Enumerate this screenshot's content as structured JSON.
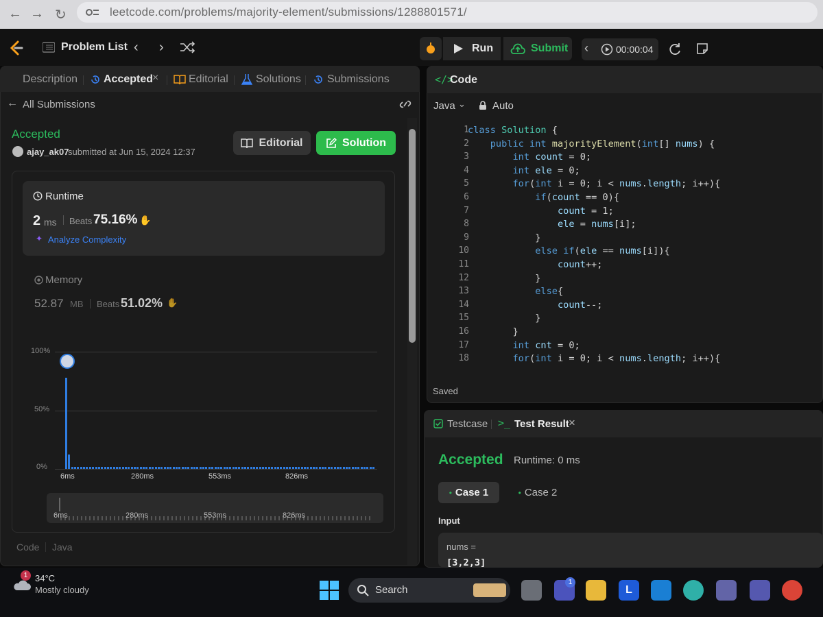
{
  "browser": {
    "url": "leetcode.com/problems/majority-element/submissions/1288801571/"
  },
  "header": {
    "problem_list": "Problem List",
    "run": "Run",
    "submit": "Submit",
    "timer": "00:00:04"
  },
  "left": {
    "tabs": [
      "Description",
      "Accepted",
      "Editorial",
      "Solutions",
      "Submissions"
    ],
    "back": "All Submissions",
    "status": "Accepted",
    "user": "ajay_ak07",
    "submitted": "submitted at Jun 15, 2024 12:37",
    "editorial_btn": "Editorial",
    "solution_btn": "Solution",
    "runtime": {
      "label": "Runtime",
      "value": "2",
      "unit": "ms",
      "beats_label": "Beats",
      "beats": "75.16%",
      "analyze": "Analyze Complexity"
    },
    "memory": {
      "label": "Memory",
      "value": "52.87",
      "unit": "MB",
      "beats_label": "Beats",
      "beats": "51.02%"
    },
    "chart_y": [
      "100%",
      "50%",
      "0%"
    ],
    "chart_x": [
      "6ms",
      "280ms",
      "553ms",
      "826ms"
    ],
    "footer_code": "Code",
    "footer_lang": "Java"
  },
  "chart_data": {
    "type": "bar",
    "x": [
      "6ms",
      "280ms",
      "553ms",
      "826ms"
    ],
    "series": [
      {
        "values": [
          78,
          12,
          1,
          1,
          1,
          1,
          1,
          1
        ]
      }
    ],
    "ylim": [
      0,
      100
    ]
  },
  "code": {
    "title": "Code",
    "language": "Java",
    "mode": "Auto",
    "lines": [
      "class Solution {",
      "    public int majorityElement(int[] nums) {",
      "        int count = 0;",
      "        int ele = 0;",
      "        for(int i = 0; i < nums.length; i++){",
      "            if(count == 0){",
      "                count = 1;",
      "                ele = nums[i];",
      "            }",
      "            else if(ele == nums[i]){",
      "                count++;",
      "            }",
      "            else{",
      "                count--;",
      "            }",
      "        }",
      "        int cnt = 0;",
      "        for(int i = 0; i < nums.length; i++){"
    ],
    "saved": "Saved"
  },
  "result": {
    "tab_testcase": "Testcase",
    "tab_result": "Test Result",
    "status": "Accepted",
    "runtime": "Runtime: 0 ms",
    "case1": "Case 1",
    "case2": "Case 2",
    "input_label": "Input",
    "param": "nums =",
    "value": "[3,2,3]"
  },
  "taskbar": {
    "temp": "34°C",
    "weather": "Mostly cloudy",
    "search": "Search"
  },
  "colors": {
    "accent_green": "#2dbb4c",
    "accepted_green": "#2cbb5d",
    "bar_blue": "#2f7de1"
  }
}
